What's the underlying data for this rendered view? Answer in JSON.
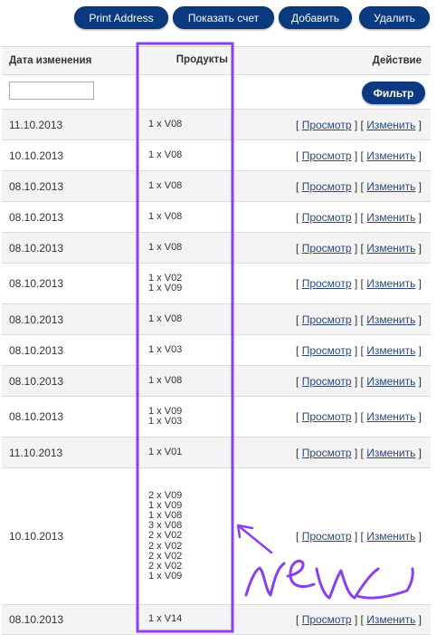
{
  "toolbar": {
    "print_address": "Print Address",
    "show_invoice": "Показать счет",
    "add": "Добавить",
    "delete": "Удалить"
  },
  "table": {
    "headers": {
      "date": "Дата изменения",
      "products": "Продукты",
      "action": "Действие"
    },
    "filter": {
      "value": "",
      "button": "Фильтр"
    },
    "action_labels": {
      "view": "Просмотр",
      "edit": "Изменить"
    },
    "rows": [
      {
        "date": "11.10.2013",
        "products": [
          "1 x V08"
        ]
      },
      {
        "date": "10.10.2013",
        "products": [
          "1 x V08"
        ]
      },
      {
        "date": "08.10.2013",
        "products": [
          "1 x V08"
        ]
      },
      {
        "date": "08.10.2013",
        "products": [
          "1 x V08"
        ]
      },
      {
        "date": "08.10.2013",
        "products": [
          "1 x V08"
        ]
      },
      {
        "date": "08.10.2013",
        "products": [
          "1 x V02",
          "1 x V09"
        ]
      },
      {
        "date": "08.10.2013",
        "products": [
          "1 x V08"
        ]
      },
      {
        "date": "08.10.2013",
        "products": [
          "1 x V03"
        ]
      },
      {
        "date": "08.10.2013",
        "products": [
          "1 x V08"
        ]
      },
      {
        "date": "08.10.2013",
        "products": [
          "1 x V09",
          "1 x V03"
        ]
      },
      {
        "date": "11.10.2013",
        "products": [
          "1 x V01"
        ]
      },
      {
        "date": "10.10.2013",
        "products": [
          "2 x V09",
          "1 x V09",
          "1 x V08",
          "3 x V08",
          "2 x V02",
          "2 x V02",
          "2 x V02",
          "2 x V02",
          "1 x V09"
        ]
      },
      {
        "date": "08.10.2013",
        "products": [
          "1 x V14"
        ]
      }
    ]
  },
  "annotation": {
    "color": "#8a3ff0",
    "text": "new"
  }
}
